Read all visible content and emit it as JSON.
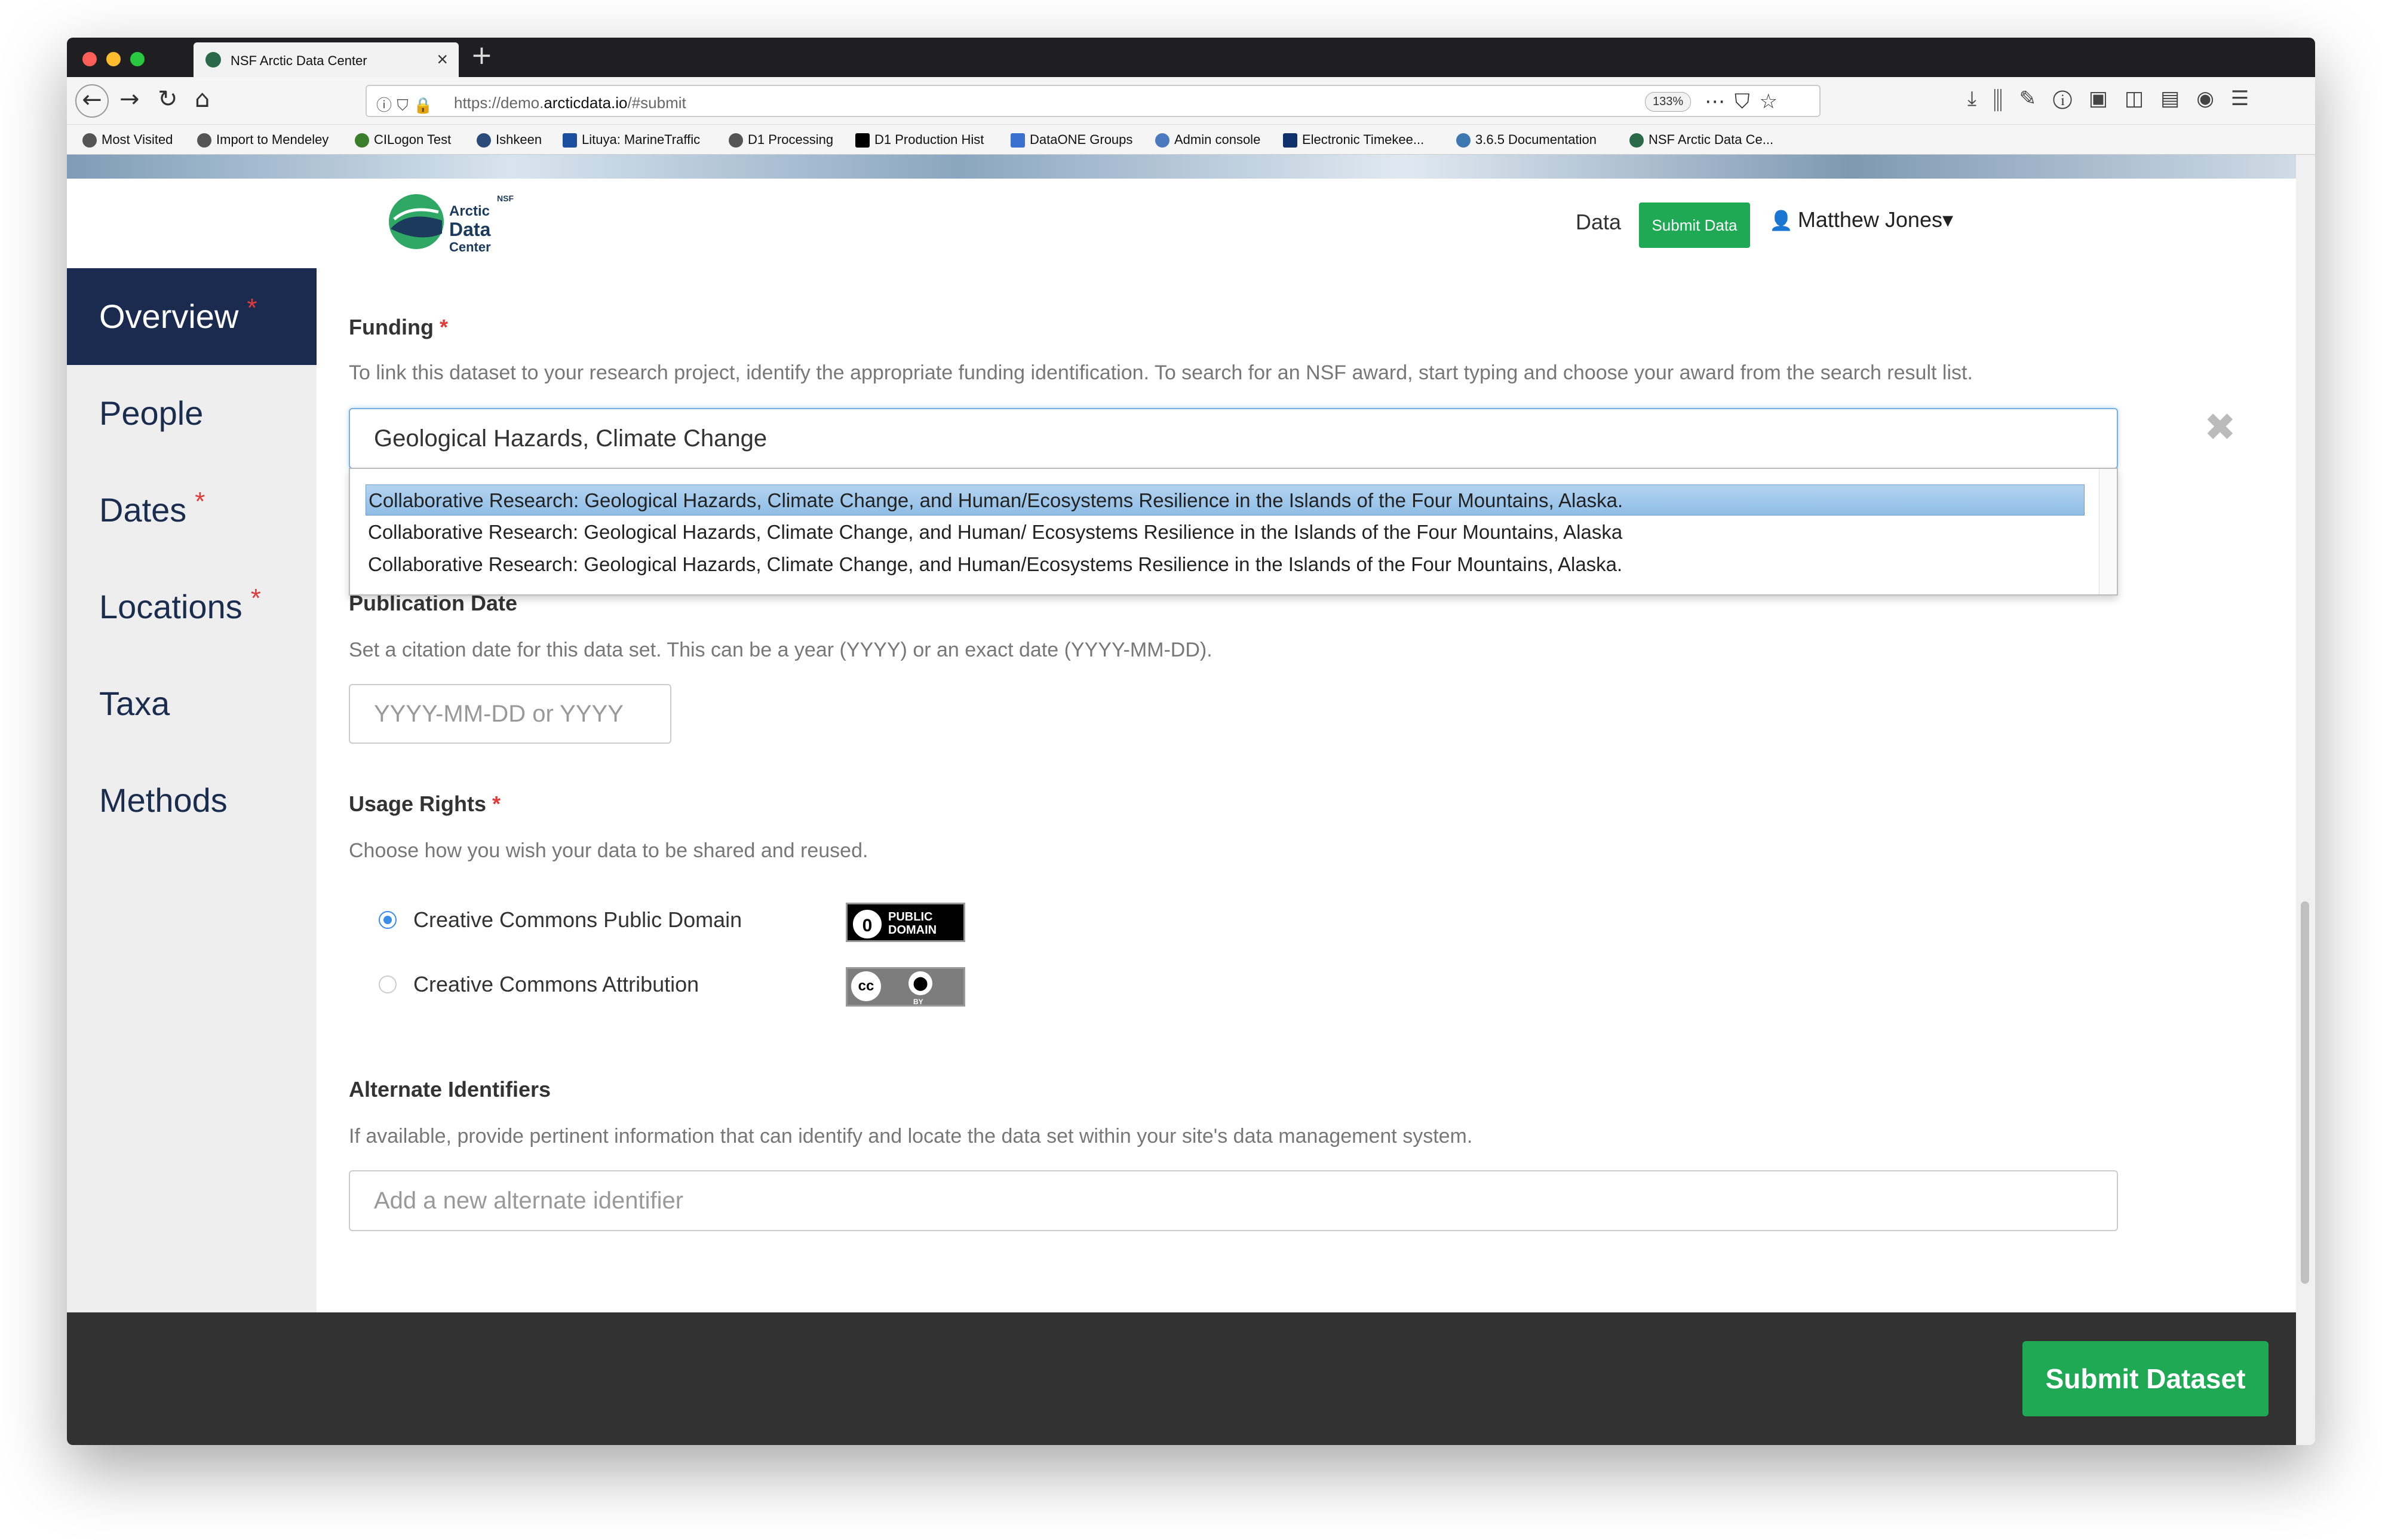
{
  "browser": {
    "tab_title": "NSF Arctic Data Center",
    "url_prefix": "https://demo.",
    "url_domain": "arcticdata.io",
    "url_path": "/#submit",
    "zoom": "133%",
    "bookmarks": [
      "Most Visited",
      "Import to Mendeley",
      "CILogon Test",
      "Ishkeen",
      "Lituya: MarineTraffic",
      "D1 Processing",
      "D1 Production Hist",
      "DataONE Groups",
      "Admin console",
      "Electronic Timekee...",
      "3.6.5 Documentation",
      "NSF Arctic Data Ce..."
    ]
  },
  "header": {
    "logo_nsf": "NSF",
    "logo_line1": "Arctic",
    "logo_line2": "Data",
    "logo_line3": "Center",
    "nav_data": "Data",
    "submit_data": "Submit Data",
    "user_name": "Matthew Jones"
  },
  "sidebar": {
    "items": [
      {
        "label": "Overview",
        "required": "*"
      },
      {
        "label": "People",
        "required": ""
      },
      {
        "label": "Dates",
        "required": "*"
      },
      {
        "label": "Locations",
        "required": "*"
      },
      {
        "label": "Taxa",
        "required": ""
      },
      {
        "label": "Methods",
        "required": ""
      }
    ]
  },
  "funding": {
    "label": "Funding",
    "required": "*",
    "help": "To link this dataset to your research project, identify the appropriate funding identification. To search for an NSF award, start typing and choose your award from the search result list.",
    "value": "Geological Hazards, Climate Change",
    "suggestions": [
      "Collaborative Research: Geological Hazards, Climate Change, and Human/Ecosystems Resilience in the Islands of the Four Mountains, Alaska.",
      "Collaborative Research: Geological Hazards, Climate Change, and Human/ Ecosystems Resilience in the Islands of the Four Mountains, Alaska",
      "Collaborative Research: Geological Hazards, Climate Change, and Human/Ecosystems Resilience in the Islands of the Four Mountains, Alaska."
    ]
  },
  "pubdate": {
    "label": "Publication Date",
    "help": "Set a citation date for this data set. This can be a year (YYYY) or an exact date (YYYY-MM-DD).",
    "placeholder": "YYYY-MM-DD or YYYY"
  },
  "rights": {
    "label": "Usage Rights",
    "required": "*",
    "help": "Choose how you wish your data to be shared and reused.",
    "option1": "Creative Commons Public Domain",
    "option2": "Creative Commons Attribution",
    "badge1_line1": "PUBLIC",
    "badge1_line2": "DOMAIN",
    "badge2_by": "BY"
  },
  "altids": {
    "label": "Alternate Identifiers",
    "help": "If available, provide pertinent information that can identify and locate the data set within your site's data management system.",
    "placeholder": "Add a new alternate identifier"
  },
  "footer": {
    "submit_label": "Submit Dataset"
  }
}
